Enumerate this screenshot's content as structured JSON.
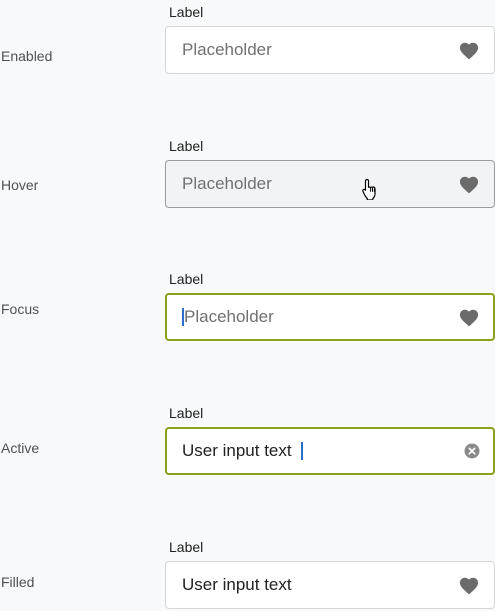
{
  "states": [
    {
      "state": "Enabled",
      "label": "Label",
      "placeholder": "Placeholder",
      "value": "",
      "icon": "heart-icon"
    },
    {
      "state": "Hover",
      "label": "Label",
      "placeholder": "Placeholder",
      "value": "",
      "icon": "heart-icon"
    },
    {
      "state": "Focus",
      "label": "Label",
      "placeholder": "Placeholder",
      "value": "",
      "icon": "heart-icon"
    },
    {
      "state": "Active",
      "label": "Label",
      "placeholder": "",
      "value": "User input text",
      "icon": "clear-icon"
    },
    {
      "state": "Filled",
      "label": "Label",
      "placeholder": "",
      "value": "User input text",
      "icon": "heart-icon"
    }
  ],
  "colors": {
    "background": "#f8f9fa",
    "border": "#d4d6d8",
    "hover_border": "#9a9b9c",
    "hover_fill": "#f2f3f4",
    "focus_border": "#8aa21a",
    "caret": "#2f6fcc",
    "icon": "#6b6b6b"
  }
}
